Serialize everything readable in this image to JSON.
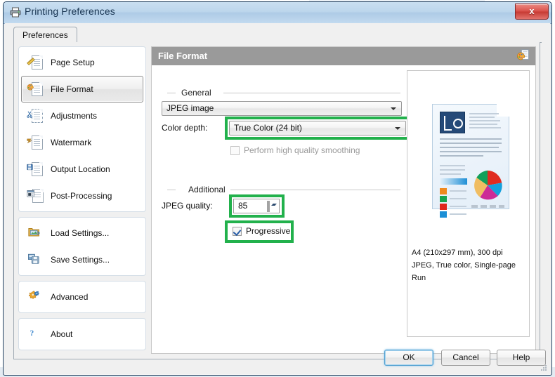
{
  "window": {
    "title": "Printing Preferences",
    "title_icon": "printer-icon",
    "close_label": "x"
  },
  "tabs": [
    {
      "label": "Preferences",
      "selected": true
    }
  ],
  "sidebar": {
    "groups": [
      {
        "items": [
          {
            "label": "Page Setup",
            "icon": "page-setup-icon",
            "selected": false
          },
          {
            "label": "File Format",
            "icon": "file-format-icon",
            "selected": true
          },
          {
            "label": "Adjustments",
            "icon": "adjustments-icon",
            "selected": false
          },
          {
            "label": "Watermark",
            "icon": "watermark-icon",
            "selected": false
          },
          {
            "label": "Output Location",
            "icon": "output-location-icon",
            "selected": false
          },
          {
            "label": "Post-Processing",
            "icon": "post-processing-icon",
            "selected": false
          }
        ]
      },
      {
        "items": [
          {
            "label": "Load Settings...",
            "icon": "load-settings-icon",
            "selected": false
          },
          {
            "label": "Save Settings...",
            "icon": "save-settings-icon",
            "selected": false
          }
        ]
      },
      {
        "items": [
          {
            "label": "Advanced",
            "icon": "gear-icon",
            "selected": false
          }
        ]
      },
      {
        "items": [
          {
            "label": "About",
            "icon": "question-mark-icon",
            "selected": false
          }
        ]
      }
    ]
  },
  "panel": {
    "title": "File Format",
    "header_icon": "file-format-icon",
    "general": {
      "caption": "General",
      "format_combo": {
        "value": "JPEG image"
      },
      "color_depth_label": "Color depth:",
      "color_depth_combo": {
        "value": "True Color (24 bit)",
        "highlighted": true
      },
      "smoothing_checkbox": {
        "label": "Perform high quality smoothing",
        "checked": false,
        "disabled": true
      }
    },
    "additional": {
      "caption": "Additional",
      "jpeg_quality_label": "JPEG quality:",
      "jpeg_quality_value": "85",
      "jpeg_quality_highlighted": true,
      "progressive_checkbox": {
        "label": "Progressive",
        "checked": true,
        "highlighted": true
      }
    }
  },
  "preview": {
    "meta_lines": [
      "A4 (210x297 mm), 300 dpi",
      "JPEG, True color, Single-page",
      "Run"
    ],
    "pie_colors": [
      "#e02b20",
      "#13a0dc",
      "#cc2a97",
      "#f0bd62",
      "#12a05a"
    ],
    "swatch_colors": [
      "#f08a1e",
      "#19a44f",
      "#e0261c",
      "#1b8fd6"
    ],
    "logo_color": "#254a78"
  },
  "footer": {
    "buttons": [
      {
        "label": "OK",
        "default": true
      },
      {
        "label": "Cancel",
        "default": false
      },
      {
        "label": "Help",
        "default": false
      }
    ]
  },
  "theme": {
    "highlight_green": "#22b14c",
    "titlebar_blue": "#bcd6ec",
    "panel_header_gray": "#9a9a9a"
  }
}
